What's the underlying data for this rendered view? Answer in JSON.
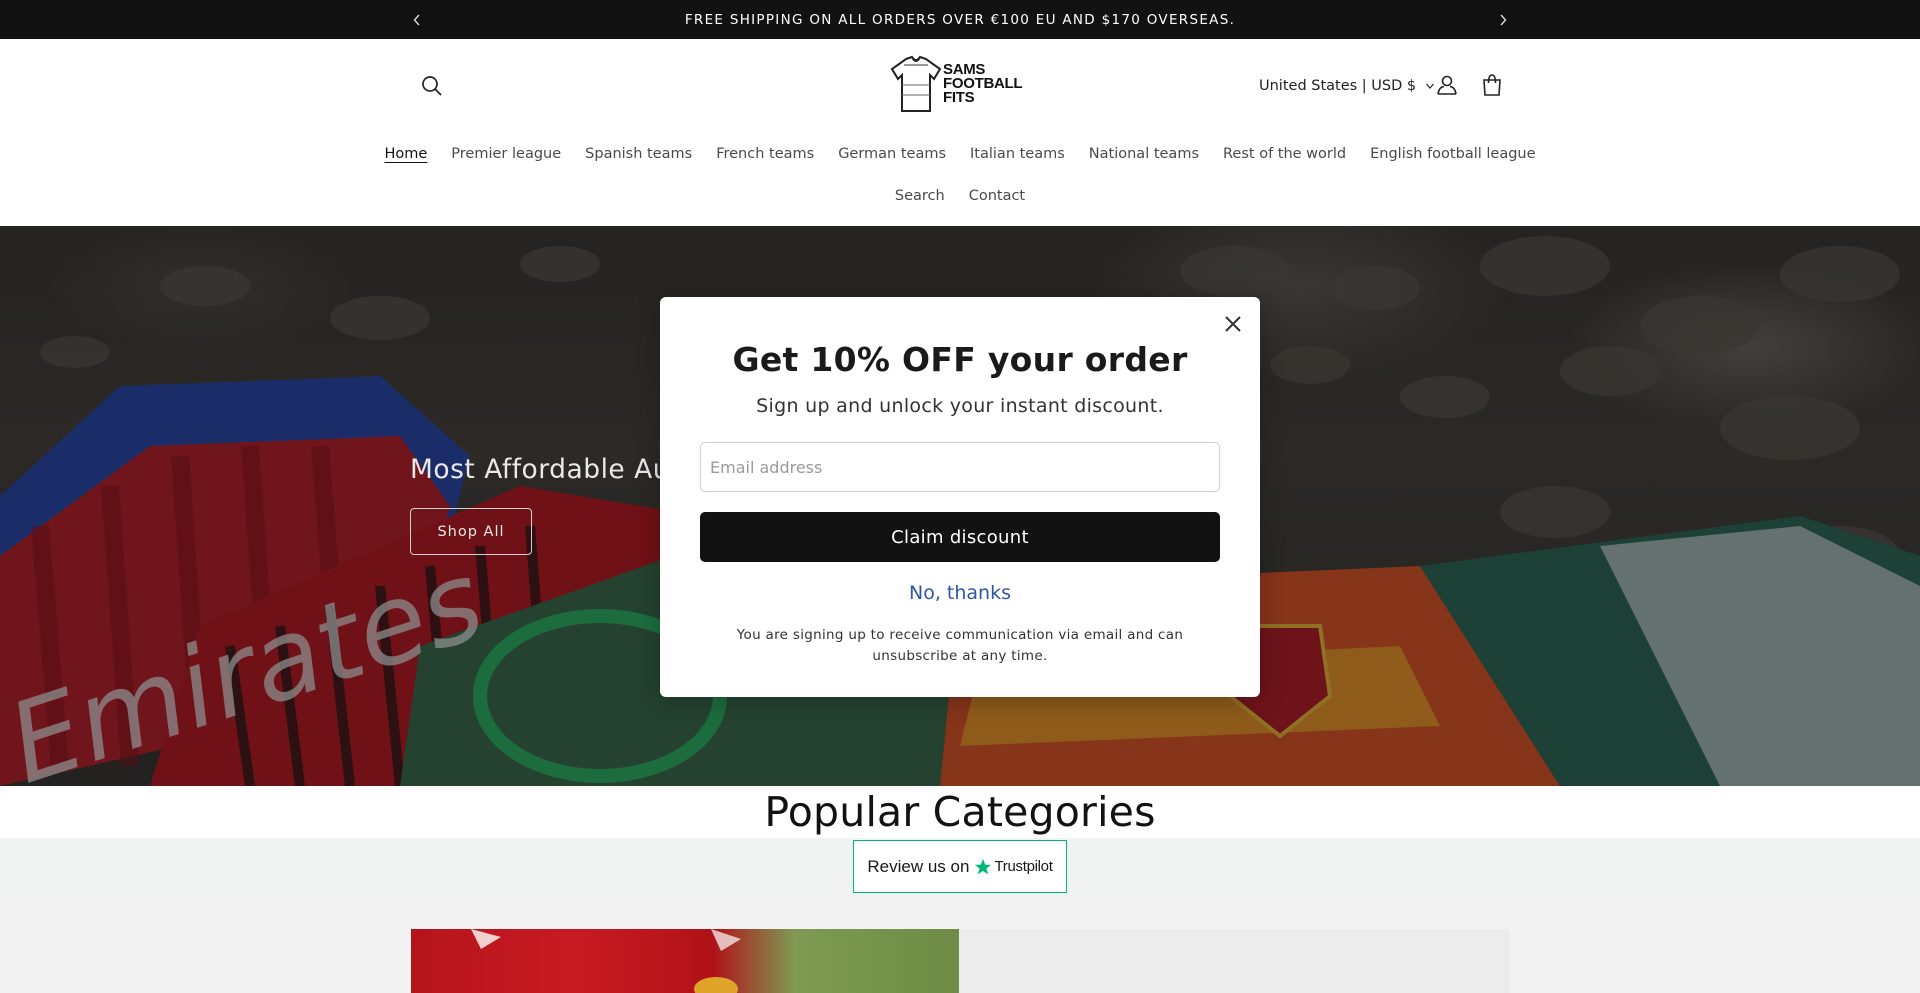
{
  "announcement": {
    "text": "FREE SHIPPING ON ALL ORDERS OVER €100 EU AND $170 OVERSEAS.",
    "prev_icon": "chevron-left",
    "next_icon": "chevron-right"
  },
  "header": {
    "logo_lines": [
      "SAMS",
      "FOOTBALL",
      "FITS"
    ],
    "country_selector": "United States | USD $",
    "icons": [
      "search-icon",
      "account-icon",
      "cart-icon"
    ]
  },
  "nav": {
    "row1": [
      "Home",
      "Premier league",
      "Spanish teams",
      "French teams",
      "German teams",
      "Italian teams",
      "National teams",
      "Rest of the world",
      "English football league"
    ],
    "row2": [
      "Search",
      "Contact"
    ],
    "active": "Home"
  },
  "hero": {
    "heading": "Most Affordable Aut",
    "button": "Shop All"
  },
  "modal": {
    "title": "Get 10% OFF your order",
    "subtitle": "Sign up and unlock your instant discount.",
    "email_placeholder": "Email address",
    "claim_button": "Claim discount",
    "decline": "No, thanks",
    "legal": "You are signing up to receive communication via email and can unsubscribe at any time."
  },
  "popular": {
    "title": "Popular Categories"
  },
  "trustpilot": {
    "label": "Review us on",
    "brand": "Trustpilot"
  },
  "colors": {
    "announcement_bg": "#121212",
    "claim_button_bg": "#121212",
    "decline_link": "#2f55a4",
    "trustpilot_green": "#00b67a"
  }
}
